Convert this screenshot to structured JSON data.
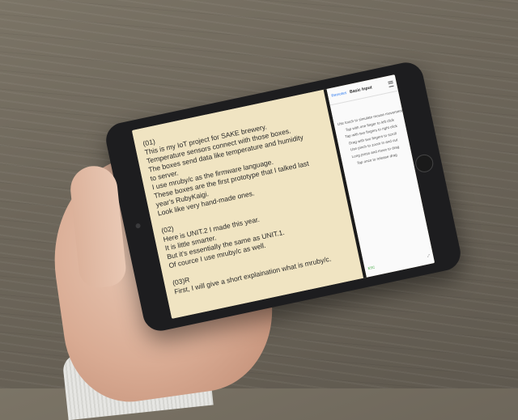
{
  "document_lines": [
    "(01)",
    "This is my IoT project for SAKE brewery.",
    "Temperature sensors connect with those boxes.",
    "The boxes send data like temperature and humidity",
    "to server.",
    "I use mruby/c as the firmware language.",
    "These boxes are the first prototype that I talked last",
    "year's RubyKaigi.",
    "Look like very hand-made ones.",
    "",
    "(02)",
    "Here is UNIT.2 I made this year.",
    "It is little smarter.",
    "But it's essentially the same as UNIT.1.",
    "Of cource I use mruby/c as well.",
    "",
    "(03)R",
    "First, I will give a short explaination what is mruby/c."
  ],
  "side_app": {
    "back_label": "Remotes",
    "title": "Basic Input",
    "instructions": [
      "Use touch to simulate mouse movement",
      "Tap with one finger to left click",
      "Tap with two fingers to right click",
      "Drag with two fingers to scroll",
      "Use pinch to zoom in and out",
      "Long press and move to drag",
      "Tap once to release drag"
    ],
    "bottom_left": "ESC",
    "bottom_right_icon": "expand-icon"
  },
  "colors": {
    "document_bg": "#f0e4c2",
    "link_blue": "#2e7bf0",
    "table_wood": "#6d665a"
  }
}
